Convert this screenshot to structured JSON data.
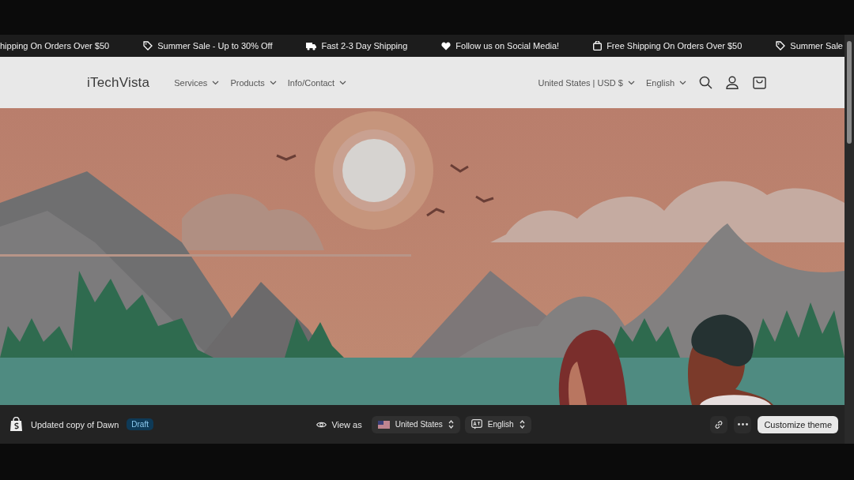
{
  "announcement_bar": {
    "items": [
      {
        "kind": "plain",
        "text": "hipping On Orders Over $50"
      },
      {
        "kind": "tag",
        "text": "Summer Sale - Up to 30% Off"
      },
      {
        "kind": "truck",
        "text": "Fast 2-3 Day Shipping"
      },
      {
        "kind": "heart",
        "text": "Follow us on Social Media!"
      },
      {
        "kind": "bag",
        "text": "Free Shipping On Orders Over $50"
      },
      {
        "kind": "tag",
        "text": "Summer Sale"
      }
    ]
  },
  "header": {
    "logo": "iTechVista",
    "nav": [
      "Services",
      "Products",
      "Info/Contact"
    ],
    "country": "United States | USD $",
    "language": "English"
  },
  "admin_bar": {
    "theme_name": "Updated copy of Dawn",
    "status": "Draft",
    "view_as": "View as",
    "country": "United States",
    "language": "English",
    "primary_button": "Customize theme"
  }
}
